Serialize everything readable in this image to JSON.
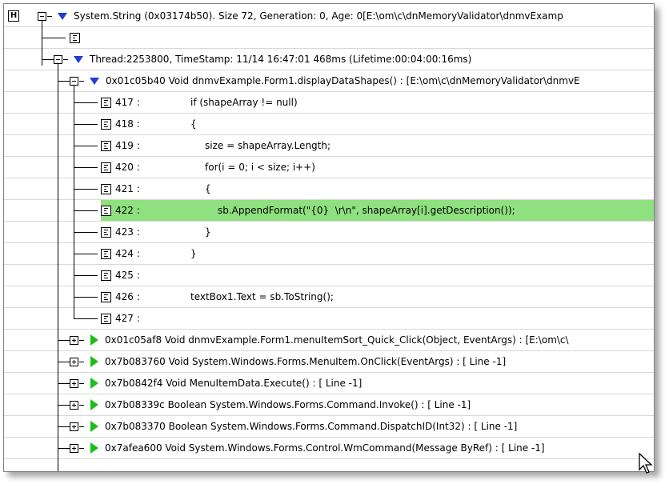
{
  "root": {
    "icon": "heap-icon",
    "icon_glyph": "H",
    "text": "System.String  (0x03174b50). Size 72, Generation: 0, Age: 0[E:\\om\\c\\dnMemoryValidator\\dnmvExamp"
  },
  "thread": {
    "text": "Thread:2253800, TimeStamp: 11/14 16:47:01 468ms (Lifetime:00:04:00:16ms)"
  },
  "frame": {
    "text": "0x01c05b40 Void dnmvExample.Form1.displayDataShapes() : [E:\\om\\c\\dnMemoryValidator\\dnmvE"
  },
  "source_lines": [
    {
      "lineno": "417  :",
      "code": "if (shapeArray != null)",
      "indent": 0
    },
    {
      "lineno": "418  :",
      "code": "{",
      "indent": 0
    },
    {
      "lineno": "419  :",
      "code": "size = shapeArray.Length;",
      "indent": 1
    },
    {
      "lineno": "420  :",
      "code": "for(i = 0; i < size; i++)",
      "indent": 1
    },
    {
      "lineno": "421  :",
      "code": "{",
      "indent": 1
    },
    {
      "lineno": "422  :",
      "code": "sb.AppendFormat(\"{0}  \\r\\n\", shapeArray[i].getDescription());",
      "indent": 2,
      "highlight": true
    },
    {
      "lineno": "423  :",
      "code": "}",
      "indent": 1
    },
    {
      "lineno": "424  :",
      "code": "}",
      "indent": 0
    },
    {
      "lineno": "425  :",
      "code": "",
      "indent": 0
    },
    {
      "lineno": "426  :",
      "code": "textBox1.Text = sb.ToString();",
      "indent": 0
    },
    {
      "lineno": "427  :",
      "code": "",
      "indent": 0
    }
  ],
  "callstack": [
    "0x01c05af8 Void dnmvExample.Form1.menuItemSort_Quick_Click(Object, EventArgs) : [E:\\om\\c\\",
    "0x7b083760 Void System.Windows.Forms.MenuItem.OnClick(EventArgs) : [ Line -1]",
    "0x7b0842f4 Void MenuItemData.Execute() : [ Line -1]",
    "0x7b08339c Boolean System.Windows.Forms.Command.Invoke() : [ Line -1]",
    "0x7b083370 Boolean System.Windows.Forms.Command.DispatchID(Int32) : [ Line -1]",
    "0x7afea600 Void System.Windows.Forms.Control.WmCommand(Message ByRef) : [ Line -1]"
  ],
  "colors": {
    "highlight": "#8fe07f",
    "triangle_blue": "#1f3fd0",
    "triangle_green": "#18c018"
  }
}
